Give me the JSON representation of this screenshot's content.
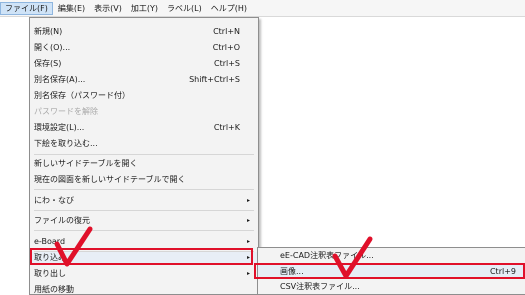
{
  "menubar": [
    {
      "label": "ファイル(F)",
      "active": true
    },
    {
      "label": "編集(E)"
    },
    {
      "label": "表示(V)"
    },
    {
      "label": "加工(Y)"
    },
    {
      "label": "ラベル(L)"
    },
    {
      "label": "ヘルプ(H)"
    }
  ],
  "file_menu": {
    "new": {
      "label": "新規(N)",
      "shortcut": "Ctrl+N"
    },
    "open": {
      "label": "開く(O)...",
      "shortcut": "Ctrl+O"
    },
    "save": {
      "label": "保存(S)",
      "shortcut": "Ctrl+S"
    },
    "save_as": {
      "label": "別名保存(A)...",
      "shortcut": "Shift+Ctrl+S"
    },
    "save_as_password": {
      "label": "別名保存（パスワード付）"
    },
    "remove_password": {
      "label": "パスワードを解除"
    },
    "environment": {
      "label": "環境設定(L)...",
      "shortcut": "Ctrl+K"
    },
    "import_underlay": {
      "label": "下絵を取り込む..."
    },
    "open_side_table": {
      "label": "新しいサイドテーブルを開く"
    },
    "open_current_side_table": {
      "label": "現在の図面を新しいサイドテーブルで開く"
    },
    "niwa_navi": {
      "label": "にわ・なび"
    },
    "file_restore": {
      "label": "ファイルの復元"
    },
    "e_board": {
      "label": "e-Board"
    },
    "import": {
      "label": "取り込み"
    },
    "export": {
      "label": "取り出し"
    },
    "paper_move": {
      "label": "用紙の移動"
    }
  },
  "import_submenu": {
    "ecad": {
      "label": "eE-CAD注釈表ファイル..."
    },
    "image": {
      "label": "画像...",
      "shortcut": "Ctrl+9"
    },
    "csv": {
      "label": "CSV注釈表ファイル..."
    }
  },
  "colors": {
    "highlight": "#e0102a"
  }
}
